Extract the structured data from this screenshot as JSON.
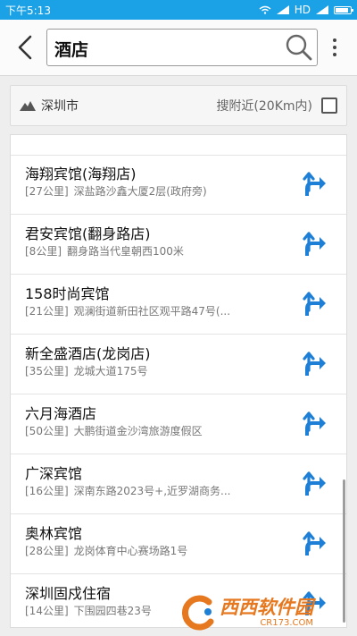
{
  "status_bar": {
    "time": "下午5:13",
    "network": "HD"
  },
  "search": {
    "query": "酒店"
  },
  "filter": {
    "city": "深圳市",
    "nearby_label": "搜附近(20Km内)"
  },
  "results": [
    {
      "name": "海翔宾馆(海翔店)",
      "distance": "[27公里]",
      "address": "深盐路沙鑫大厦2层(政府旁)"
    },
    {
      "name": "君安宾馆(翻身路店)",
      "distance": "[8公里]",
      "address": "翻身路当代皇朝西100米"
    },
    {
      "name": "158时尚宾馆",
      "distance": "[21公里]",
      "address": "观澜街道新田社区观平路47号(..."
    },
    {
      "name": "新全盛酒店(龙岗店)",
      "distance": "[35公里]",
      "address": "龙城大道175号"
    },
    {
      "name": "六月海酒店",
      "distance": "[50公里]",
      "address": "大鹏街道金沙湾旅游度假区"
    },
    {
      "name": "广深宾馆",
      "distance": "[16公里]",
      "address": "深南东路2023号+,近罗湖商务..."
    },
    {
      "name": "奥林宾馆",
      "distance": "[28公里]",
      "address": "龙岗体育中心赛场路1号"
    },
    {
      "name": "深圳固戍住宿",
      "distance": "[14公里]",
      "address": "下围园四巷23号"
    }
  ],
  "watermark": {
    "main": "西西软件园",
    "url": "CR173.COM"
  },
  "colors": {
    "status_bar": "#1ba2e6",
    "nav_arrow": "#1e7fd6",
    "watermark": "#e6781f"
  }
}
